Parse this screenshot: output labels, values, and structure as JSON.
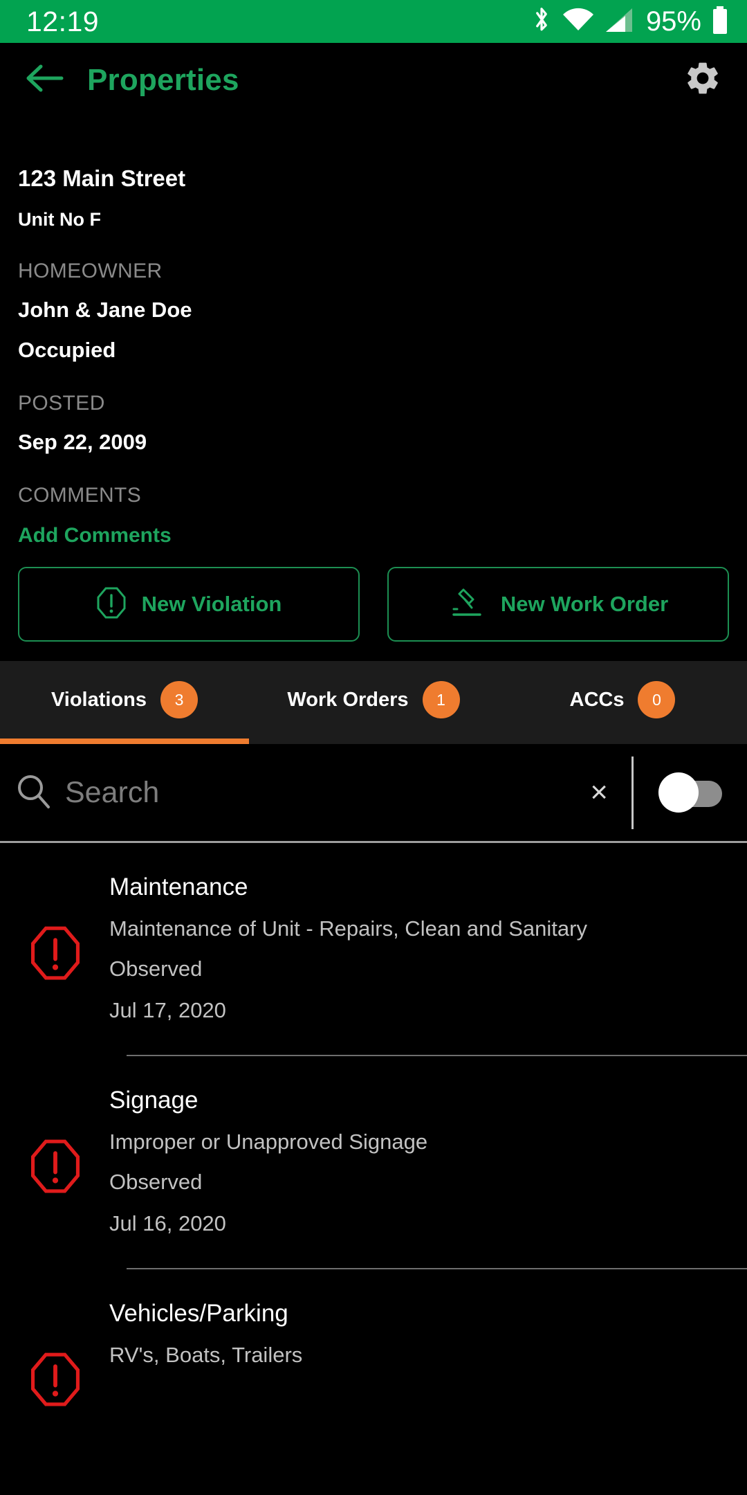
{
  "status_bar": {
    "time": "12:19",
    "battery_percent": "95%",
    "icons": [
      "bluetooth-icon",
      "wifi-icon",
      "cellular-signal-icon",
      "battery-icon"
    ],
    "background_color": "#02a350"
  },
  "app_bar": {
    "back_label": "back-arrow",
    "title": "Properties",
    "settings_label": "gear-icon",
    "accent_color": "#1ea55e"
  },
  "property": {
    "address": "123 Main Street",
    "unit": "Unit No F",
    "homeowner_label": "HOMEOWNER",
    "homeowner_name": "John & Jane Doe",
    "occupancy": "Occupied",
    "posted_label": "POSTED",
    "posted_date": "Sep 22, 2009",
    "comments_label": "COMMENTS",
    "add_comments": "Add Comments"
  },
  "actions": {
    "new_violation": "New Violation",
    "new_work_order": "New Work Order"
  },
  "tabs": [
    {
      "label": "Violations",
      "count": "3",
      "active": true
    },
    {
      "label": "Work Orders",
      "count": "1",
      "active": false
    },
    {
      "label": "ACCs",
      "count": "0",
      "active": false
    }
  ],
  "tab_accent_color": "#ef7c2f",
  "search": {
    "placeholder": "Search",
    "value": "",
    "clear_label": "×",
    "toggle_on": false
  },
  "violations": [
    {
      "title": "Maintenance",
      "description": "Maintenance of Unit - Repairs, Clean and Sanitary",
      "status": "Observed",
      "date": "Jul 17, 2020"
    },
    {
      "title": "Signage",
      "description": "Improper or Unapproved Signage",
      "status": "Observed",
      "date": "Jul 16, 2020"
    },
    {
      "title": "Vehicles/Parking",
      "description": "RV's, Boats, Trailers",
      "status": "",
      "date": ""
    }
  ],
  "violation_icon_color": "#e01b1b"
}
